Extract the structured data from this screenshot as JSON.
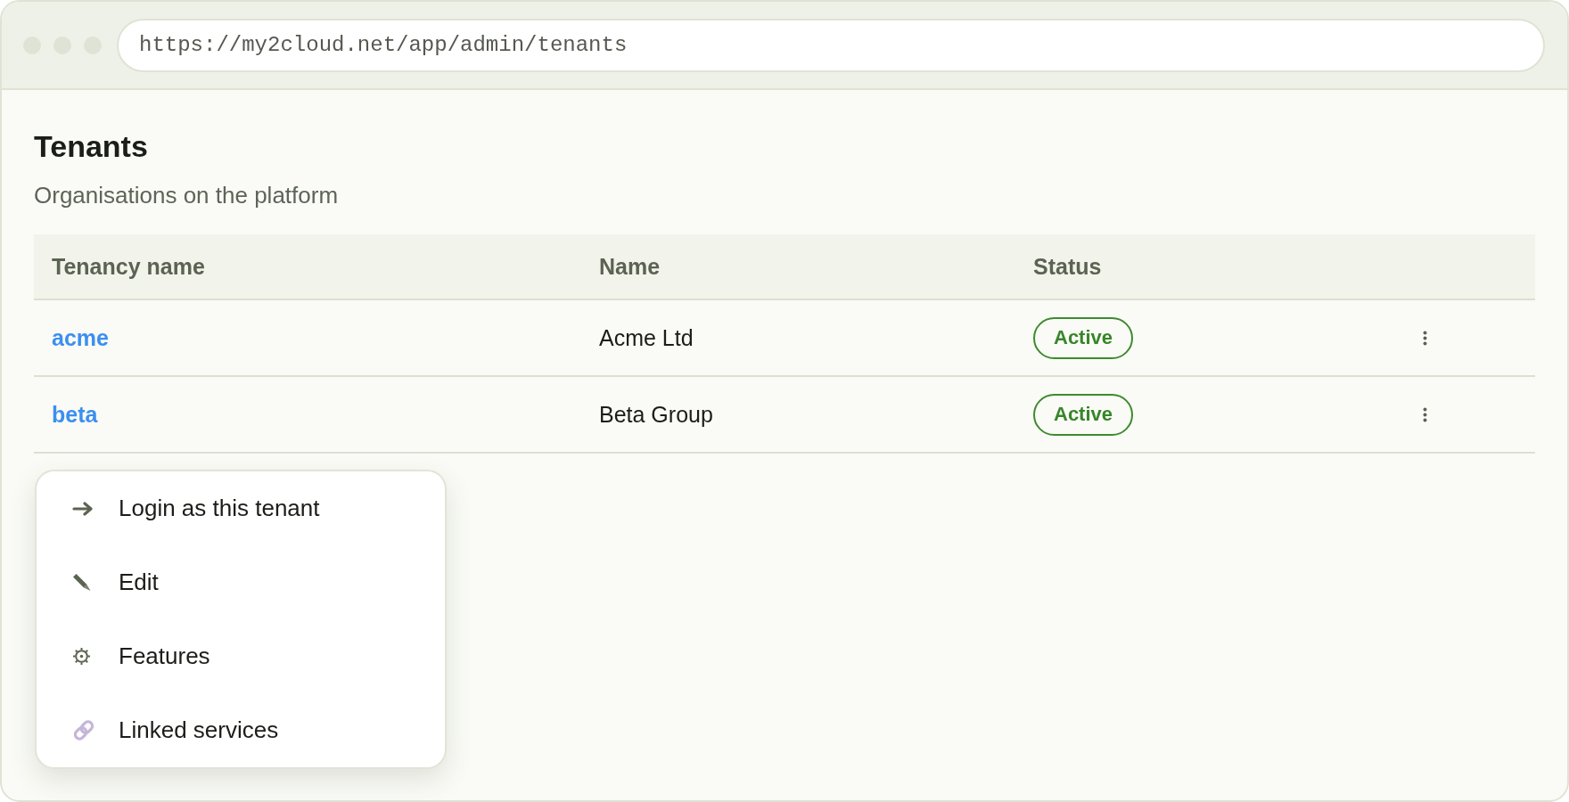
{
  "browser": {
    "url": "https://my2cloud.net/app/admin/tenants"
  },
  "page": {
    "title": "Tenants",
    "subtitle": "Organisations on the platform"
  },
  "table": {
    "columns": [
      "Tenancy name",
      "Name",
      "Status"
    ],
    "rows": [
      {
        "tenancy_name": "acme",
        "name": "Acme Ltd",
        "status": "Active"
      },
      {
        "tenancy_name": "beta",
        "name": "Beta Group",
        "status": "Active"
      }
    ]
  },
  "menu": {
    "items": [
      {
        "kind": "login",
        "label": "Login as this tenant"
      },
      {
        "kind": "edit",
        "label": "Edit"
      },
      {
        "kind": "features",
        "label": "Features"
      },
      {
        "kind": "linked",
        "label": "Linked services"
      }
    ]
  }
}
